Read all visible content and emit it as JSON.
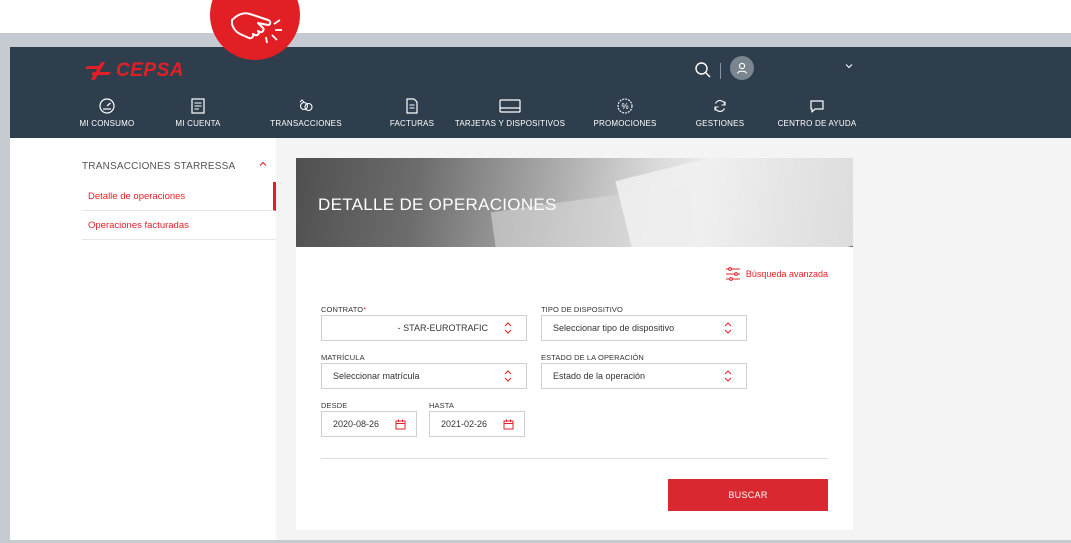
{
  "brand": {
    "name": "CEPSA",
    "accent": "#e31f26",
    "header_bg": "#2f3e4d"
  },
  "header": {
    "icons": [
      "search-icon",
      "user-avatar",
      "chevron-down-icon"
    ],
    "nav": [
      {
        "label": "MI CONSUMO",
        "icon": "gauge-icon"
      },
      {
        "label": "MI CUENTA",
        "icon": "account-icon"
      },
      {
        "label": "TRANSACCIONES",
        "icon": "transactions-icon"
      },
      {
        "label": "FACTURAS",
        "icon": "invoice-icon"
      },
      {
        "label": "TARJETAS Y DISPOSITIVOS",
        "icon": "card-icon"
      },
      {
        "label": "PROMOCIONES",
        "icon": "percent-icon"
      },
      {
        "label": "GESTIONES",
        "icon": "refresh-icon"
      },
      {
        "label": "CENTRO DE AYUDA",
        "icon": "chat-icon"
      }
    ]
  },
  "sidebar": {
    "section_title": "TRANSACCIONES STARRESSA",
    "items": [
      {
        "label": "Detalle de operaciones",
        "active": true
      },
      {
        "label": "Operaciones facturadas",
        "active": false
      }
    ]
  },
  "main": {
    "banner_title": "DETALLE DE OPERACIONES",
    "advanced_search": "Búsqueda avanzada",
    "contrato": {
      "label": "CONTRATO",
      "required_mark": "*",
      "value": "- STAR-EUROTRAFIC"
    },
    "tipo_dispositivo": {
      "label": "TIPO DE DISPOSITIVO",
      "value": "Seleccionar tipo de dispositivo"
    },
    "matricula": {
      "label": "MATRÍCULA",
      "value": "Seleccionar matrícula"
    },
    "estado": {
      "label": "ESTADO DE LA OPERACIÓN",
      "value": "Estado de la operación"
    },
    "desde": {
      "label": "DESDE",
      "value": "2020-08-26"
    },
    "hasta": {
      "label": "HASTA",
      "value": "2021-02-26"
    },
    "search_button": "BUSCAR"
  }
}
